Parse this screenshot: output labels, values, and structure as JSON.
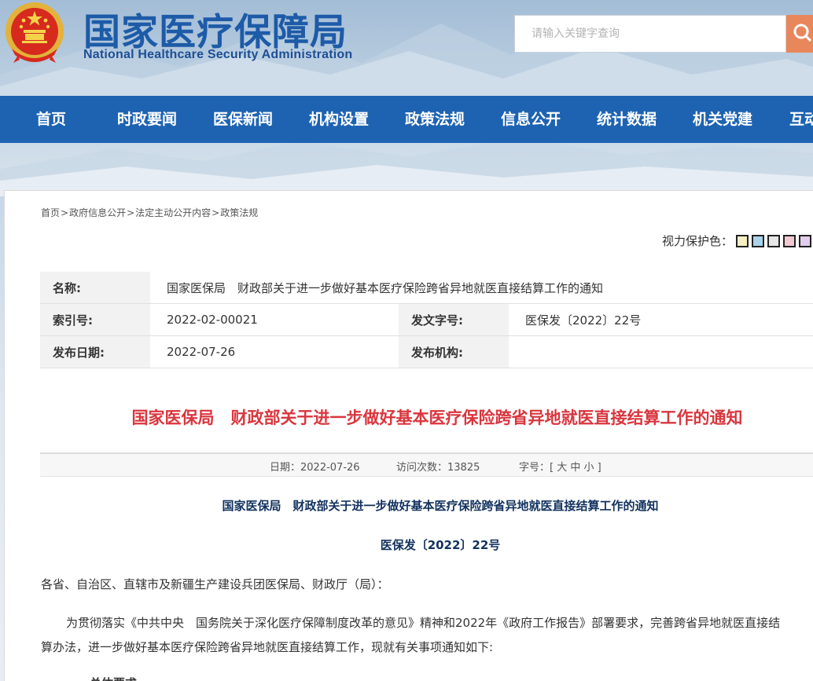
{
  "site": {
    "title": "国家医疗保障局",
    "subtitle": "National Healthcare Security Administration"
  },
  "search": {
    "placeholder": "请输入关键字查询",
    "button_icon": "search-icon"
  },
  "nav": {
    "items": [
      "首页",
      "时政要闻",
      "医保新闻",
      "机构设置",
      "政策法规",
      "信息公开",
      "统计数据",
      "机关党建",
      "互动"
    ]
  },
  "breadcrumb": {
    "items": [
      "首页",
      "政府信息公开",
      "法定主动公开内容",
      "政策法规"
    ],
    "separator": ">"
  },
  "eye_protect": {
    "label": "视力保护色：",
    "colors": [
      "#f7efc4",
      "#a9d3ec",
      "#e6e6e6",
      "#f2c8d2",
      "#e2cdee"
    ]
  },
  "info": {
    "name_label": "名称:",
    "name_value": "国家医保局　财政部关于进一步做好基本医疗保险跨省异地就医直接结算工作的通知",
    "index_label": "索引号:",
    "index_value": "2022-02-00021",
    "doc_no_label": "发文字号:",
    "doc_no_value": "医保发〔2022〕22号",
    "date_label": "发布日期:",
    "date_value": "2022-07-26",
    "org_label": "发布机构:",
    "org_value": ""
  },
  "article": {
    "title": "国家医保局　财政部关于进一步做好基本医疗保险跨省异地就医直接结算工作的通知",
    "meta": {
      "date": "日期：2022-07-26",
      "visits": "访问次数：13825",
      "font_size": "字号：[ 大 中 小 ]"
    },
    "heading": "国家医保局　财政部关于进一步做好基本医疗保险跨省异地就医直接结算工作的通知",
    "doc_number": "医保发〔2022〕22号",
    "addressee": "各省、自治区、直辖市及新疆生产建设兵团医保局、财政厅（局）：",
    "para1_line1": "为贯彻落实《中共中央　国务院关于深化医疗保障制度改革的意见》精神和2022年《政府工作报告》部署要求，完善跨省异地就医直接结",
    "para1_line2": "算办法，进一步做好基本医疗保险跨省异地就医直接结算工作，现就有关事项通知如下:",
    "next_heading": "一、总体要求"
  }
}
